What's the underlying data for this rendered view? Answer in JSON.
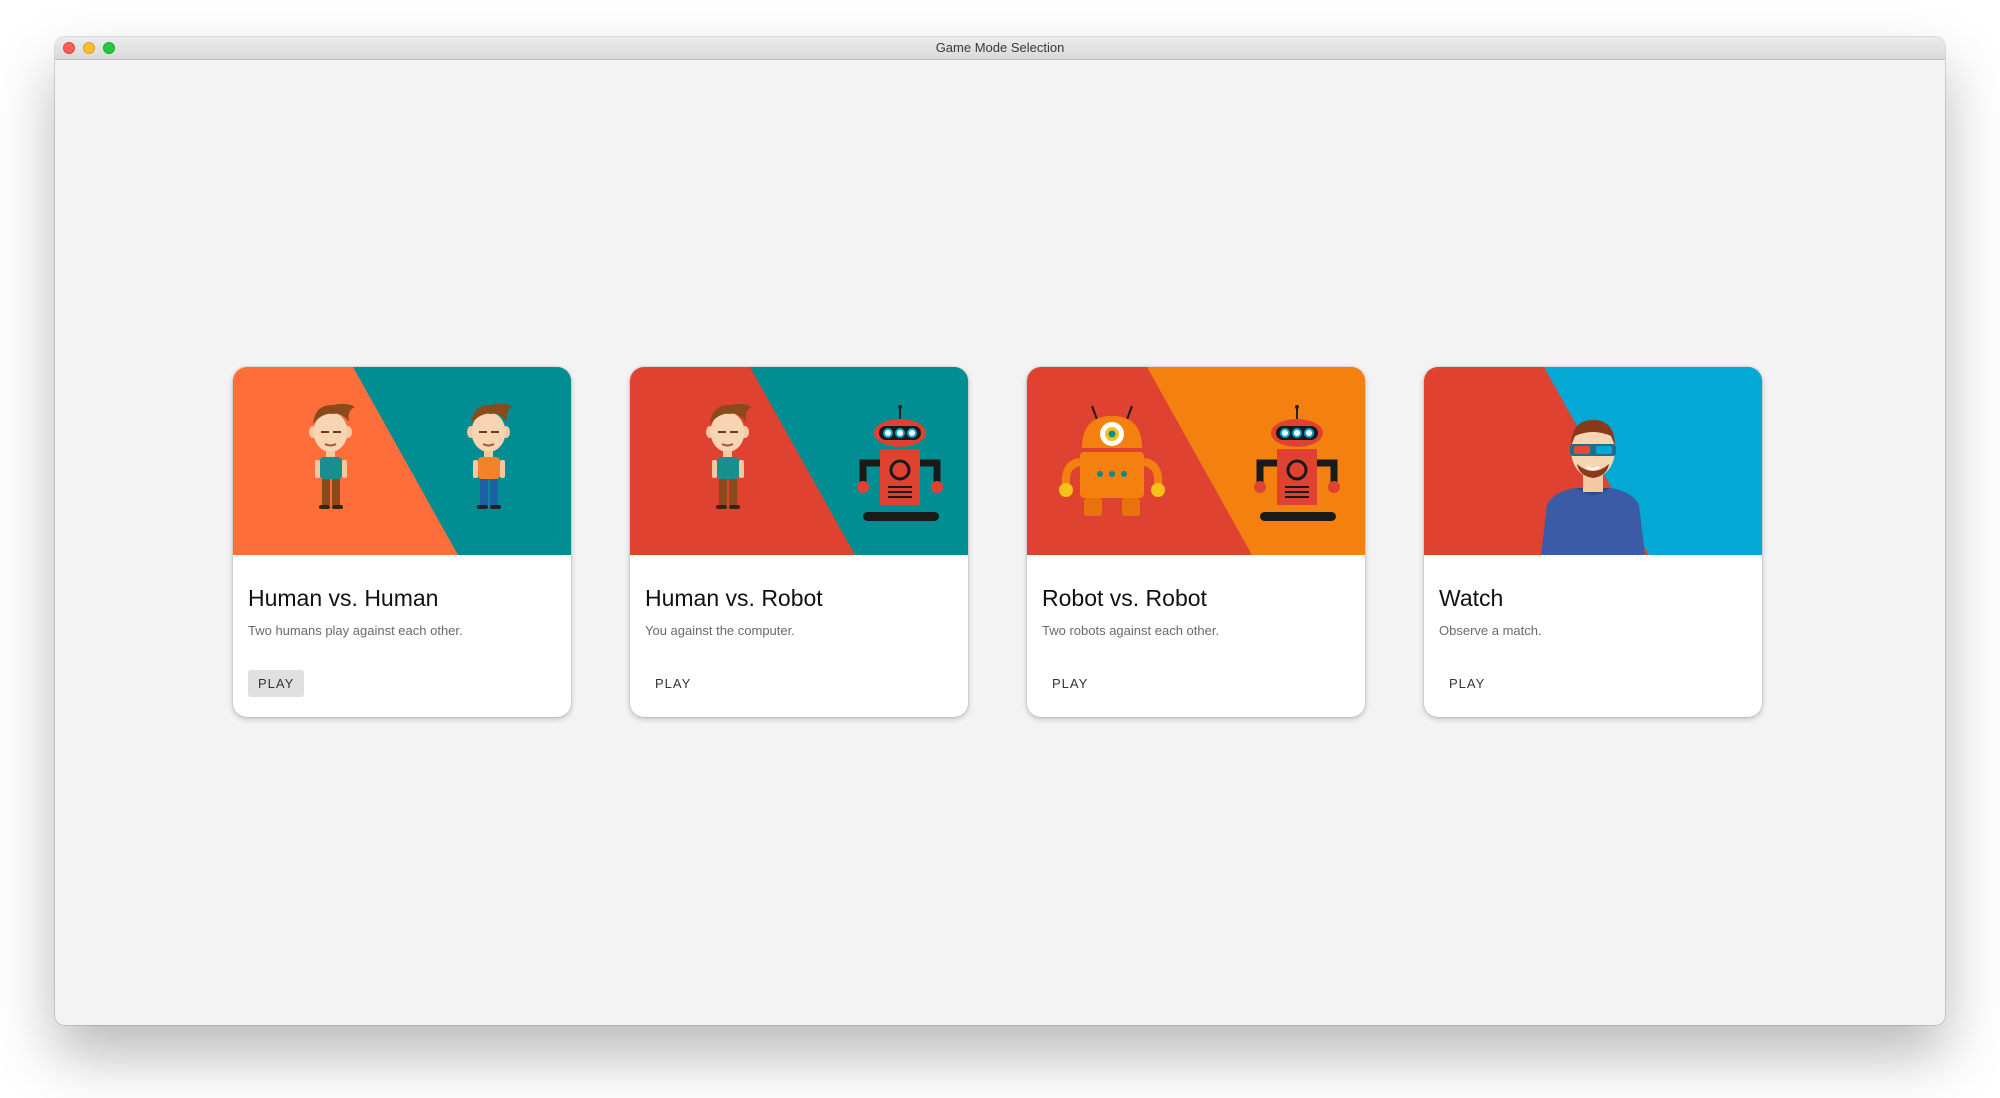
{
  "window": {
    "title": "Game Mode Selection"
  },
  "cards": [
    {
      "title": "Human vs. Human",
      "description": "Two humans play against each other.",
      "button": "PLAY",
      "colors": {
        "left": "#fe6e3a",
        "right": "#018e93"
      },
      "figures": [
        "human-icon",
        "human-icon"
      ]
    },
    {
      "title": "Human vs. Robot",
      "description": "You against the computer.",
      "button": "PLAY",
      "colors": {
        "left": "#df4230",
        "right": "#018e93"
      },
      "figures": [
        "human-icon",
        "robot-icon"
      ]
    },
    {
      "title": "Robot vs. Robot",
      "description": "Two robots against each other.",
      "button": "PLAY",
      "colors": {
        "left": "#df4230",
        "right": "#f4800f"
      },
      "figures": [
        "robot-icon",
        "robot-icon"
      ]
    },
    {
      "title": "Watch",
      "description": "Observe a match.",
      "button": "PLAY",
      "colors": {
        "left": "#df4230",
        "right": "#03a9d4"
      },
      "figures": [
        "spectator-icon"
      ]
    }
  ]
}
